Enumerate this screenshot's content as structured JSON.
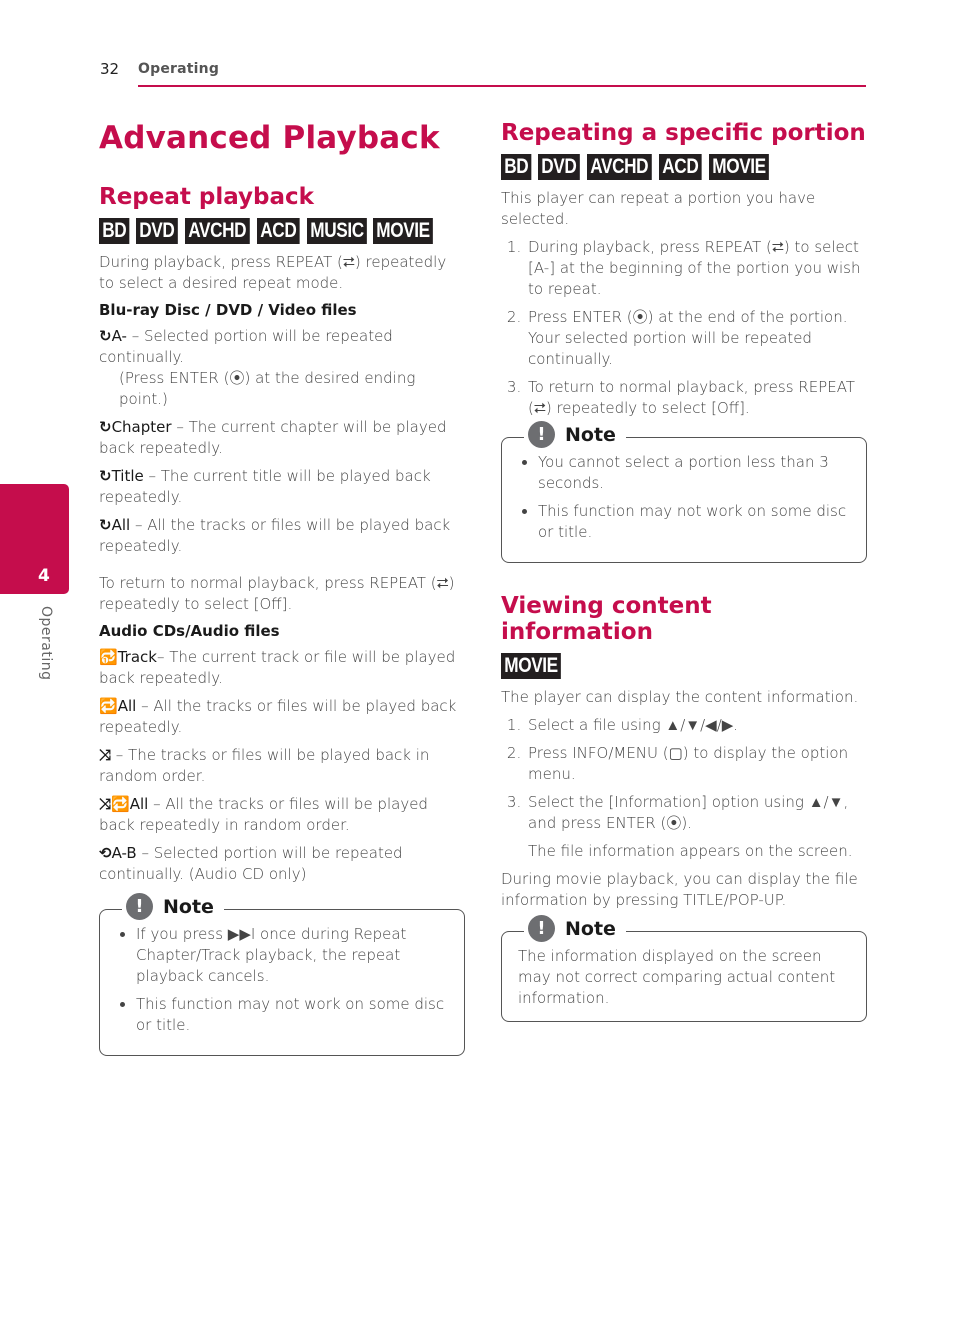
{
  "header": {
    "page_number": "32",
    "section": "Operating"
  },
  "side_tab": {
    "chapter_number": "4",
    "chapter_label": "Operating"
  },
  "left": {
    "title": "Advanced Playback",
    "repeat": {
      "heading": "Repeat playback",
      "badges": [
        "BD",
        "DVD",
        "AVCHD",
        "ACD",
        "MUSIC",
        "MOVIE"
      ],
      "intro": "During playback, press REPEAT (⮂) repeatedly to select a desired repeat mode.",
      "video_heading": "Blu-ray Disc / DVD / Video files",
      "video_items": [
        {
          "icon": "repeat-icon",
          "glyph": "↻",
          "label": "A-",
          "text": " – Selected portion will be repeated continually.",
          "sub": "(Press ENTER (⦿) at the desired ending point.)"
        },
        {
          "icon": "repeat-icon",
          "glyph": "↻",
          "label": "Chapter",
          "text": " – The current chapter will be played back repeatedly."
        },
        {
          "icon": "repeat-icon",
          "glyph": "↻",
          "label": "Title",
          "text": " – The current title will be played back repeatedly."
        },
        {
          "icon": "repeat-icon",
          "glyph": "↻",
          "label": "All",
          "text": " – All the tracks or files will be played back repeatedly."
        }
      ],
      "return_text": "To return to normal playback, press REPEAT (⮂) repeatedly to select [Off].",
      "audio_heading": "Audio CDs/Audio files",
      "audio_items": [
        {
          "icon": "repeat-one-icon",
          "glyph": "🔂",
          "label": "Track",
          "text": "– The current track or file will be played back repeatedly."
        },
        {
          "icon": "repeat-all-icon",
          "glyph": "🔁",
          "label": "All",
          "text": " – All the tracks or files will be played back repeatedly."
        },
        {
          "icon": "shuffle-icon",
          "glyph": "⤨",
          "label": "",
          "text": "  – The tracks or files will be played back in random order."
        },
        {
          "icon": "shuffle-repeat-all-icon",
          "glyph": "⤨🔁",
          "label": "All",
          "text": " – All the tracks or files will be played back repeatedly in random order."
        },
        {
          "icon": "repeat-ab-icon",
          "glyph": "⟲",
          "label": "A-B",
          "text": " – Selected portion will be repeated continually. (Audio CD only)"
        }
      ],
      "note": {
        "title": "Note",
        "items": [
          "If you press ▶▶I once during Repeat Chapter/Track playback, the repeat playback cancels.",
          "This function may not work on some disc or title."
        ]
      }
    }
  },
  "right": {
    "portion": {
      "heading": "Repeating a specific portion",
      "badges": [
        "BD",
        "DVD",
        "AVCHD",
        "ACD",
        "MOVIE"
      ],
      "intro": "This player can repeat a portion you have selected.",
      "steps": [
        "During playback, press REPEAT (⮂) to select [A-] at the beginning of the portion you wish to repeat.",
        "Press ENTER (⦿) at the end of the portion. Your selected portion will be repeated continually.",
        "To return to normal playback, press REPEAT (⮂) repeatedly to select [Off]."
      ],
      "note": {
        "title": "Note",
        "items": [
          "You cannot select a portion less than 3 seconds.",
          "This function may not work on some disc or title."
        ]
      }
    },
    "info": {
      "heading": "Viewing content information",
      "badges": [
        "MOVIE"
      ],
      "intro": "The player can display the content information.",
      "steps": [
        "Select a file using ▲/▼/◀/▶.",
        "Press INFO/MENU (▢) to display the option menu.",
        "Select the [Information] option using ▲/▼, and press ENTER (⦿)."
      ],
      "step3_sub": "The file information appears on the screen.",
      "after": "During movie playback, you can display the file information by pressing TITLE/POP-UP.",
      "note": {
        "title": "Note",
        "text": "The information displayed on the screen may not correct comparing actual content information."
      }
    }
  }
}
